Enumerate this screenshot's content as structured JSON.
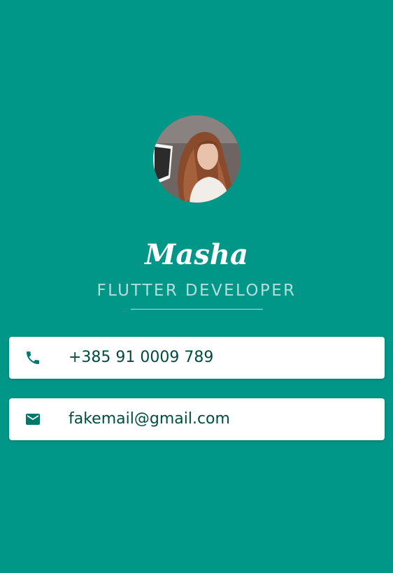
{
  "profile": {
    "name": "Masha",
    "title": "FLUTTER DEVELOPER"
  },
  "contacts": {
    "phone": {
      "icon": "phone-icon",
      "value": "+385 91 0009 789"
    },
    "email": {
      "icon": "mail-icon",
      "value": "fakemail@gmail.com"
    }
  },
  "colors": {
    "background": "#009688",
    "card": "#ffffff",
    "accent_text": "#004d40",
    "subtitle": "#b2dfdb"
  }
}
